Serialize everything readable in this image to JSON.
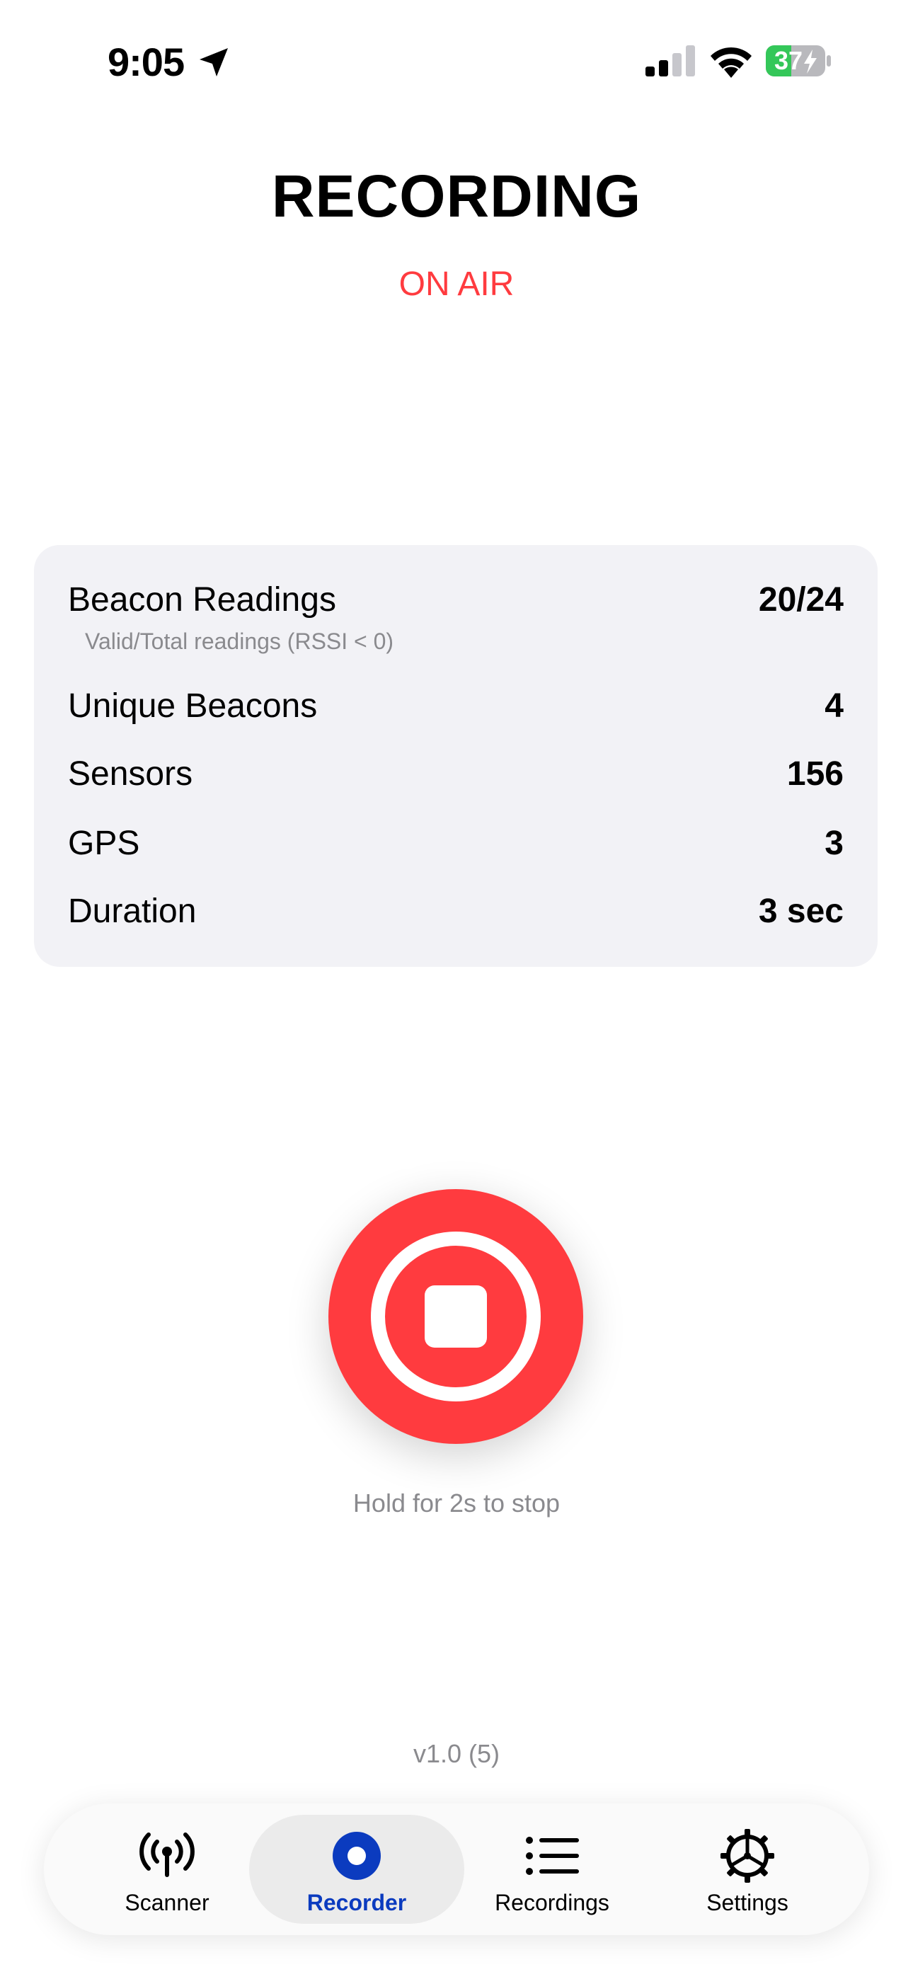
{
  "status_bar": {
    "time": "9:05",
    "battery_level": "37",
    "location_icon": "location-arrow-icon",
    "signal_icon": "cellular-signal-icon",
    "wifi_icon": "wifi-icon",
    "battery_icon": "battery-charging-icon"
  },
  "header": {
    "title": "RECORDING",
    "status": "ON AIR"
  },
  "stats": {
    "beacon_readings": {
      "label": "Beacon Readings",
      "value": "20/24",
      "subtext": "Valid/Total readings (RSSI < 0)"
    },
    "unique_beacons": {
      "label": "Unique Beacons",
      "value": "4"
    },
    "sensors": {
      "label": "Sensors",
      "value": "156"
    },
    "gps": {
      "label": "GPS",
      "value": "3"
    },
    "duration": {
      "label": "Duration",
      "value": "3 sec"
    }
  },
  "stop_button": {
    "icon": "stop-icon",
    "hint": "Hold for 2s to stop"
  },
  "version": "v1.0 (5)",
  "tabs": [
    {
      "label": "Scanner",
      "icon": "antenna-icon",
      "active": false
    },
    {
      "label": "Recorder",
      "icon": "record-icon",
      "active": true
    },
    {
      "label": "Recordings",
      "icon": "list-icon",
      "active": false
    },
    {
      "label": "Settings",
      "icon": "gear-icon",
      "active": false
    }
  ],
  "colors": {
    "accent_red": "#ff3b3f",
    "tab_active": "#0b3bbf",
    "card_bg": "#f2f2f6",
    "battery_green": "#34c759",
    "secondary_text": "#8a8a8e"
  }
}
